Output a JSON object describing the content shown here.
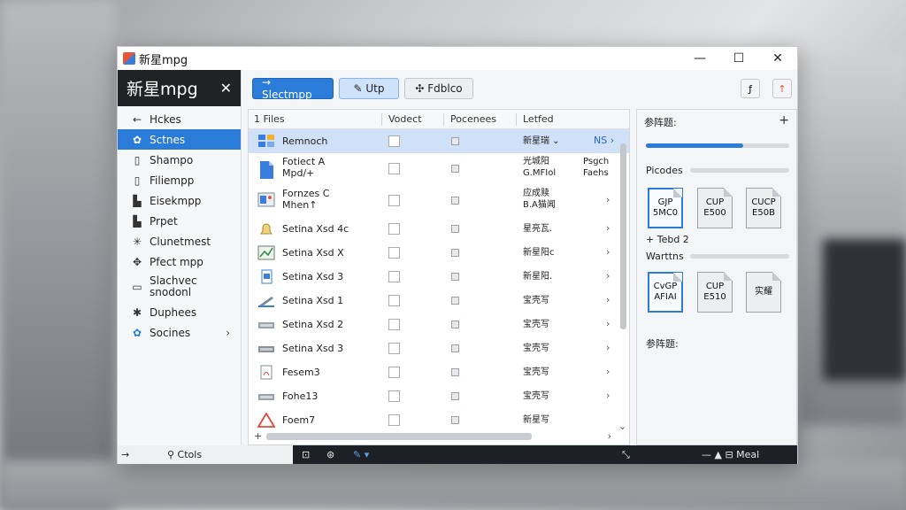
{
  "window": {
    "title": "新星mpg",
    "controls": [
      "—",
      "☐",
      "✕"
    ]
  },
  "sidebar": {
    "header": "新星mpg",
    "close": "✕",
    "items": [
      {
        "icon": "←",
        "label": "Hckes"
      },
      {
        "icon": "✿",
        "label": "Sctnes"
      },
      {
        "icon": "▯",
        "label": "Shampo"
      },
      {
        "icon": "▯",
        "label": "Filiempp"
      },
      {
        "icon": "▙",
        "label": "Eisekmpp"
      },
      {
        "icon": "▙",
        "label": "Prpet"
      },
      {
        "icon": "✳",
        "label": "Clunetmest"
      },
      {
        "icon": "✥",
        "label": "Pfect mpp"
      },
      {
        "icon": "▭",
        "label": "Slachvec",
        "label2": "snodonl"
      },
      {
        "icon": "✱",
        "label": "Duphees"
      },
      {
        "icon": "✿",
        "label": "Socines",
        "chev": "›"
      }
    ]
  },
  "toolbar": {
    "primary": "→  Slectmpp",
    "selected": "✎  Utp",
    "plain": "✣  Fdblco",
    "icon1": "ƒ",
    "icon2": "↑"
  },
  "table": {
    "headers": [
      "1 Files",
      "Vodect",
      "Pocenees",
      "Letfed"
    ],
    "rows": [
      {
        "name": "Remnoch",
        "label": "新星瑞 ⌄",
        "extra": "NS ›"
      },
      {
        "name": "Fotiect A",
        "name2": "Mpd/+",
        "label": "光城阳",
        "label2": "G.MFIol",
        "extra": "Psgch",
        "extra2": "Faehs"
      },
      {
        "name": "Fornzes C",
        "name2": "Mhen↑",
        "label": "应成赎",
        "label2": "B.A猫闻"
      },
      {
        "name": "Setina Xsd 4c",
        "label": "星亮瓦."
      },
      {
        "name": "Setina Xsd X",
        "label": "新星阳c"
      },
      {
        "name": "Setina Xsd 3",
        "label": "新星阳."
      },
      {
        "name": "Setina Xsd 1",
        "label": "宝壳写"
      },
      {
        "name": "Setina Xsd 2",
        "label": "宝壳写"
      },
      {
        "name": "Setina Xsd 3",
        "label": "宝壳写"
      },
      {
        "name": "Fesem3",
        "label": "宝壳写"
      },
      {
        "name": "Fohe13",
        "label": "宝壳写"
      },
      {
        "name": "Foem7",
        "label": "新星写"
      }
    ]
  },
  "right_panel": {
    "title": "参阵题:",
    "plus": "+",
    "progress": 0.68,
    "section1": "Picodes",
    "docs1": [
      {
        "l1": "GJP",
        "l2": "5MC0",
        "highlight": true
      },
      {
        "l1": "CUP",
        "l2": "E500",
        "highlight": false
      },
      {
        "l1": "CUCP",
        "l2": "E50B",
        "highlight": false
      }
    ],
    "tell": "+ Tebd 2",
    "section2": "Warttns",
    "docs2": [
      {
        "l1": "CvGP",
        "l2": "AFIAI",
        "highlight": true
      },
      {
        "l1": "CUP",
        "l2": "E510",
        "highlight": false
      },
      {
        "l1": "实耀",
        "l2": "",
        "highlight": false
      }
    ],
    "footer": "参阵题:"
  },
  "status": {
    "arrow": "→",
    "search": "⚲  Ctols",
    "icons": [
      "⊡",
      "⊛",
      "✎ ▾"
    ],
    "right_icon": "⤡",
    "right_text": "— ▲ ⊟  Meal"
  }
}
